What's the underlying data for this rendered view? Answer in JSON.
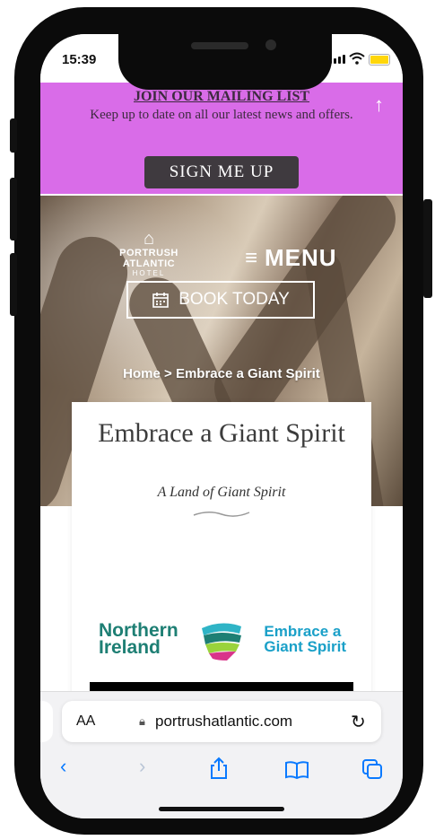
{
  "status_bar": {
    "time": "15:39"
  },
  "mailing_list": {
    "title": "JOIN OUR MAILING LIST",
    "text": "Keep up to date on all our latest news and offers.",
    "button": "SIGN ME UP",
    "background": "#d96ce8"
  },
  "header": {
    "logo_name": "PORTRUSH ATLANTIC",
    "logo_sub": "HOTEL",
    "menu_label": "MENU",
    "book_label": "BOOK TODAY"
  },
  "breadcrumb": {
    "text": "Home > Embrace a Giant Spirit"
  },
  "content": {
    "title": "Embrace a Giant Spirit",
    "subtitle": "A Land of Giant Spirit",
    "partner_logo_left_1": "Northern",
    "partner_logo_left_2": "Ireland",
    "partner_logo_right_1": "Embrace a",
    "partner_logo_right_2": "Giant Spirit"
  },
  "safari": {
    "text_size_label": "AA",
    "url": "portrushatlantic.com"
  },
  "icons": {
    "menu": "hamburger-icon",
    "book": "calendar-icon",
    "back_to_top": "arrow-up-icon",
    "lock": "lock-icon",
    "reload": "reload-icon",
    "back": "chevron-left-icon",
    "forward": "chevron-right-icon",
    "share": "share-icon",
    "bookmarks": "book-icon",
    "tabs": "tabs-icon"
  }
}
